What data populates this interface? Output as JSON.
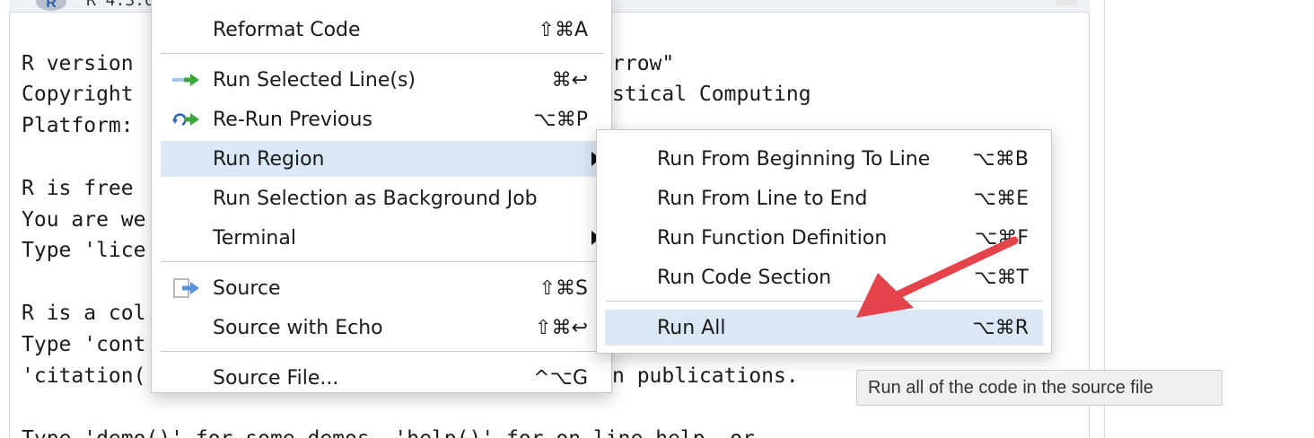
{
  "console": {
    "title": "R 4.3.0",
    "lines": [
      "R version",
      "Copyright",
      "Platform:",
      "",
      "R is free",
      "You are we",
      "Type 'lice",
      "",
      "R is a col",
      "Type 'cont",
      "'citation(",
      "",
      "Type 'demo()' for some demos, 'help()' for on-line help, or"
    ],
    "right_fragments": {
      "line1": "rrow\"",
      "line2": "stical Computing",
      "line11": "n publications."
    }
  },
  "main_menu": {
    "items": [
      {
        "label": "Reformat Code",
        "shortcut": "⇧⌘A",
        "icon": ""
      },
      {
        "label": "Run Selected Line(s)",
        "shortcut": "⌘↩",
        "icon": "run-line-icon"
      },
      {
        "label": "Re-Run Previous",
        "shortcut": "⌥⌘P",
        "icon": "rerun-icon"
      },
      {
        "label": "Run Region",
        "shortcut": "",
        "icon": "",
        "submenu": true
      },
      {
        "label": "Run Selection as Background Job",
        "shortcut": "",
        "icon": ""
      },
      {
        "label": "Terminal",
        "shortcut": "",
        "icon": "",
        "submenu": true
      },
      {
        "label": "Source",
        "shortcut": "⇧⌘S",
        "icon": "source-icon"
      },
      {
        "label": "Source with Echo",
        "shortcut": "⇧⌘↩",
        "icon": ""
      },
      {
        "label": "Source File...",
        "shortcut": "^⌥G",
        "icon": ""
      }
    ]
  },
  "sub_menu": {
    "items": [
      {
        "label": "Run From Beginning To Line",
        "shortcut": "⌥⌘B"
      },
      {
        "label": "Run From Line to End",
        "shortcut": "⌥⌘E"
      },
      {
        "label": "Run Function Definition",
        "shortcut": "⌥⌘F"
      },
      {
        "label": "Run Code Section",
        "shortcut": "⌥⌘T"
      },
      {
        "label": "Run All",
        "shortcut": "⌥⌘R"
      }
    ]
  },
  "tooltip": {
    "text": "Run all of the code in the source file"
  },
  "colors": {
    "highlight": "#dae7f4",
    "annotation_arrow": "#e5434b",
    "run_icon_green": "#3ba63b",
    "source_icon_blue": "#5b8fd6"
  }
}
